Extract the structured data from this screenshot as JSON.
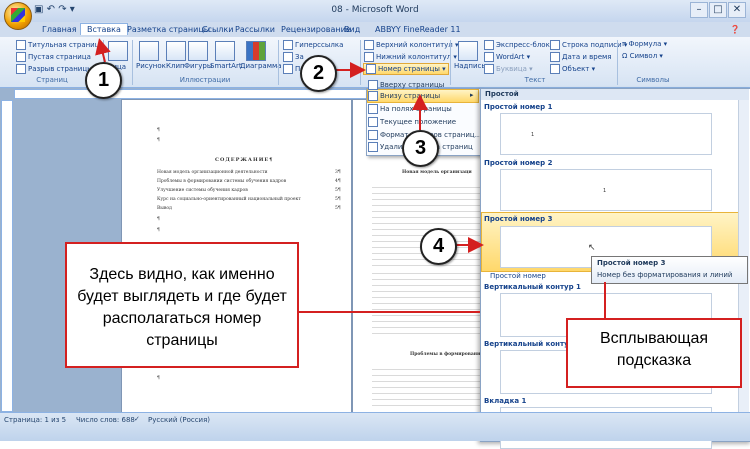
{
  "window": {
    "title": "08 - Microsoft Word"
  },
  "tabs": [
    "Главная",
    "Вставка",
    "Разметка страницы",
    "Ссылки",
    "Рассылки",
    "Рецензирование",
    "Вид",
    "ABBYY FineReader 11"
  ],
  "ribbon": {
    "pages": [
      "Титульная страница",
      "Пустая страница",
      "Разрыв страницы"
    ],
    "pages_label": "Страниц",
    "table_label": "лица",
    "illustrations": [
      "Рисунок",
      "Клип",
      "Фигуры",
      "SmartArt",
      "Диаграмма"
    ],
    "illustrations_label": "Иллюстрации",
    "links": [
      "Гиперссылка"
    ],
    "header_footer": [
      "Верхний колонтитул",
      "Нижний колонтитул",
      "Номер страницы"
    ],
    "text": {
      "textbox": "Надпись",
      "items_a": [
        "Экспресс-блоки",
        "WordArt",
        "Буквица"
      ],
      "items_b": [
        "Строка подписи",
        "Дата и время",
        "Объект"
      ],
      "label": "Текст"
    },
    "symbols": {
      "items": [
        "Формула",
        "Символ"
      ],
      "label": "Символы"
    }
  },
  "menu": {
    "items": [
      "Вверху страницы",
      "Внизу страницы",
      "На полях страницы",
      "Текущее положение",
      "Формат номеров страниц...",
      "Удалить номера страниц"
    ]
  },
  "gallery": {
    "header": "Простой",
    "items": [
      "Простой номер 1",
      "Простой номер 2",
      "Простой номер 3",
      "Простой номер",
      "Вертикальный контур 1",
      "Вертикальный контур 2",
      "Вкладка 1"
    ]
  },
  "tooltip": {
    "title": "Простой номер 3",
    "desc": "Номер без форматирования и линий"
  },
  "document": {
    "heading": "СОДЕРЖАНИЕ¶",
    "toc": [
      {
        "t": "Новая модель организационной деятельности",
        "p": "3¶"
      },
      {
        "t": "Проблемы в формировании системы обучения кадров",
        "p": "4¶"
      },
      {
        "t": "Улучшение системы обучения кадров",
        "p": "5¶"
      },
      {
        "t": "Курс на социально-ориентированный национальный проект",
        "p": "5¶"
      },
      {
        "t": "Вывод",
        "p": "5¶"
      }
    ],
    "para": "¶",
    "right_heading": "Новая модель организаци",
    "right_heading2": "Проблемы в формировании сис"
  },
  "callouts": {
    "left": "Здесь видно, как именно будет выглядеть и где будет располагаться номер страницы",
    "right": "Всплывающая подсказка",
    "numbers": [
      "1",
      "2",
      "3",
      "4"
    ]
  },
  "status": {
    "page": "Страница: 1 из 5",
    "words": "Число слов: 688",
    "lang": "Русский (Россия)"
  }
}
